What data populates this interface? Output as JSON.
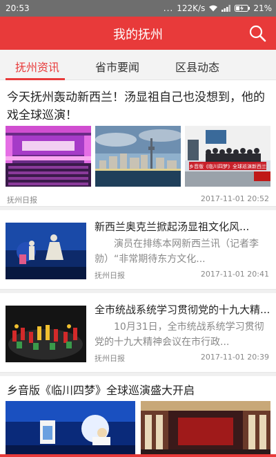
{
  "status_bar": {
    "time": "20:53",
    "dots": "...",
    "speed": "122K/s",
    "battery": "21%"
  },
  "header": {
    "title": "我的抚州"
  },
  "tabs": [
    {
      "label": "抚州资讯",
      "active": true
    },
    {
      "label": "省市要闻",
      "active": false
    },
    {
      "label": "区县动态",
      "active": false
    }
  ],
  "featured": {
    "title": "今天抚州轰动新西兰！汤显祖自己也没想到，他的戏全球巡演！",
    "source": "抚州日报",
    "time": "2017-11-01 20:52",
    "banner_text": "乡音版《临川四梦》全球巡演新西兰"
  },
  "list": [
    {
      "title": "新西兰奥克兰掀起汤显祖文化风...",
      "summary": "演员在排练本网新西兰讯（记者李勍）“非常期待东方文化...",
      "source": "抚州日报",
      "time": "2017-11-01 20:41"
    },
    {
      "title": "全市统战系统学习贯彻党的十九大精...",
      "summary": "10月31日，全市统战系统学习贯彻党的十九大精神会议在市行政...",
      "source": "抚州日报",
      "time": "2017-11-01 20:39"
    }
  ],
  "bottom_feature": {
    "title": "乡音版《临川四梦》全球巡演盛大开启"
  },
  "colors": {
    "accent": "#e83a3a",
    "status_bar": "#6e6e6e",
    "tab_bg": "#f3f3f3",
    "meta_text": "#888888"
  }
}
